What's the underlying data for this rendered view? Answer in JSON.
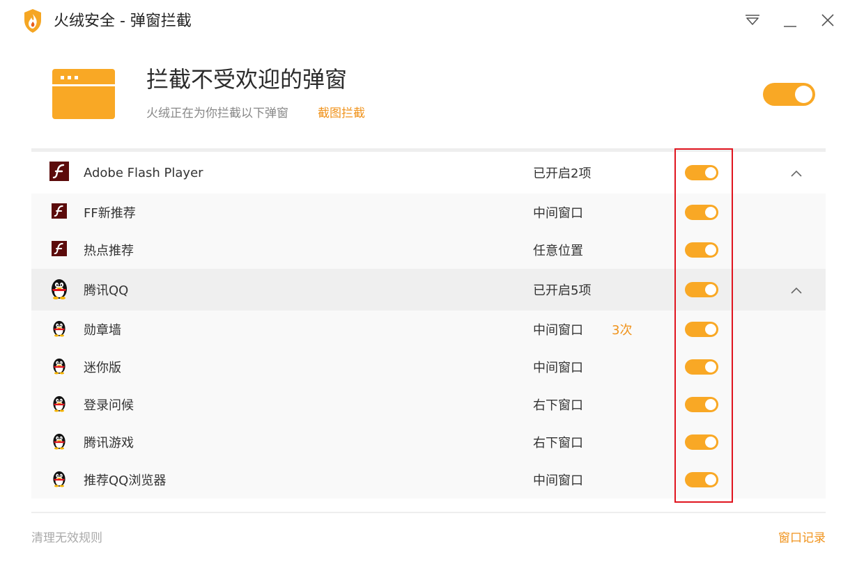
{
  "window": {
    "title": "火绒安全 - 弹窗拦截",
    "buttons": [
      "menu-icon",
      "minimize-icon",
      "close-icon"
    ]
  },
  "hero": {
    "title": "拦截不受欢迎的弹窗",
    "subtitle": "火绒正在为你拦截以下弹窗",
    "screenshot_link": "截图拦截",
    "master_enabled": true
  },
  "colors": {
    "accent": "#f9a825",
    "link": "#f0931c",
    "highlight": "#e0141e"
  },
  "groups": [
    {
      "name": "Adobe Flash Player",
      "icon": "flash-icon",
      "status": "已开启2项",
      "enabled": true,
      "expanded": true,
      "items": [
        {
          "name": "FF新推荐",
          "status": "中间窗口",
          "count": "",
          "enabled": true
        },
        {
          "name": "热点推荐",
          "status": "任意位置",
          "count": "",
          "enabled": true
        }
      ]
    },
    {
      "name": "腾讯QQ",
      "icon": "qq-penguin-icon",
      "status": "已开启5项",
      "enabled": true,
      "expanded": true,
      "items": [
        {
          "name": "勋章墙",
          "status": "中间窗口",
          "count": "3次",
          "enabled": true
        },
        {
          "name": "迷你版",
          "status": "中间窗口",
          "count": "",
          "enabled": true
        },
        {
          "name": "登录问候",
          "status": "右下窗口",
          "count": "",
          "enabled": true
        },
        {
          "name": "腾讯游戏",
          "status": "右下窗口",
          "count": "",
          "enabled": true
        },
        {
          "name": "推荐QQ浏览器",
          "status": "中间窗口",
          "count": "",
          "enabled": true
        }
      ]
    }
  ],
  "footer": {
    "clean_rules": "清理无效规则",
    "window_log": "窗口记录"
  }
}
